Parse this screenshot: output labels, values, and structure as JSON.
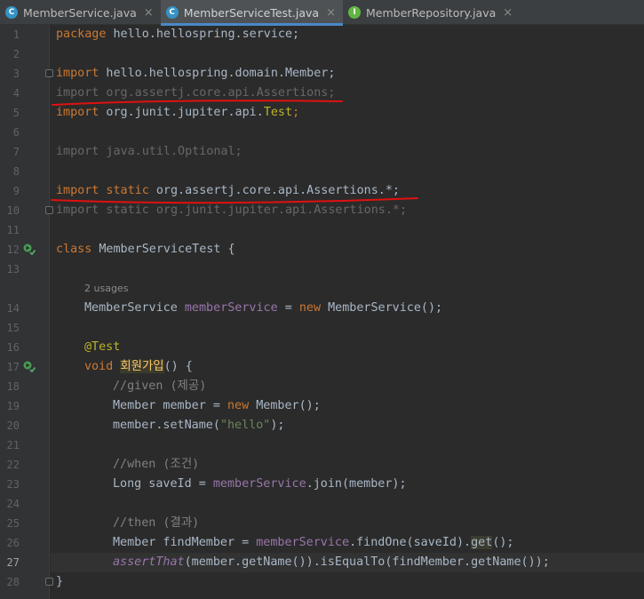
{
  "tabs": [
    {
      "label": "MemberService.java",
      "icon": "class-icon"
    },
    {
      "label": "MemberServiceTest.java",
      "icon": "class-icon",
      "active": true
    },
    {
      "label": "MemberRepository.java",
      "icon": "interface-icon"
    }
  ],
  "close_symbol": "×",
  "line_numbers": [
    "1",
    "2",
    "3",
    "4",
    "5",
    "6",
    "7",
    "8",
    "9",
    "10",
    "11",
    "12",
    "13",
    "14",
    "15",
    "16",
    "17",
    "18",
    "19",
    "20",
    "21",
    "22",
    "23",
    "24",
    "25",
    "26",
    "27",
    "28"
  ],
  "current_line": "27",
  "code": {
    "l1": {
      "kw": "package",
      "rest": " hello.hellospring.service;"
    },
    "l3": {
      "kw": "import",
      "rest": " hello.hellospring.domain.Member;"
    },
    "l4": {
      "text": "import org.assertj.core.api.Assertions;"
    },
    "l5": {
      "kw": "import",
      "rest": " org.junit.jupiter.api.",
      "ann": "Test",
      "end": ";"
    },
    "l7": {
      "text": "import java.util.Optional;"
    },
    "l9": {
      "kw": "import static",
      "rest": " org.assertj.core.api.Assertions.*;"
    },
    "l10": {
      "text": "import static org.junit.jupiter.api.Assertions.*;"
    },
    "l12": {
      "kw": "class",
      "rest": " MemberServiceTest {"
    },
    "usage_hint": "2 usages",
    "l14": {
      "type": "MemberService ",
      "field": "memberService",
      "mid": " = ",
      "kw": "new",
      "rest": " MemberService();"
    },
    "l16": {
      "ann": "@Test"
    },
    "l17": {
      "kw": "void",
      "method": "회원가입",
      "rest": "() {"
    },
    "l18": {
      "comment": "//given (제공)"
    },
    "l19": {
      "a": "Member member = ",
      "kw": "new",
      "b": " Member();"
    },
    "l20": {
      "a": "member.setName(",
      "str": "\"hello\"",
      "b": ");"
    },
    "l22": {
      "comment": "//when (조건)"
    },
    "l23": {
      "a": "Long saveId = ",
      "field": "memberService",
      "b": ".join(member);"
    },
    "l25": {
      "comment": "//then (결과)"
    },
    "l26": {
      "a": "Member findMember = ",
      "field": "memberService",
      "b": ".findOne(saveId).",
      "get": "get",
      "c": "();"
    },
    "l27": {
      "static": "assertThat",
      "rest": "(member.getName()).isEqualTo(findMember.getName());"
    },
    "l28": {
      "text": "}"
    }
  },
  "colors": {
    "background": "#2b2b2b",
    "gutter": "#313335",
    "keyword": "#cc7832",
    "annotation_marks": "#ff0000"
  }
}
